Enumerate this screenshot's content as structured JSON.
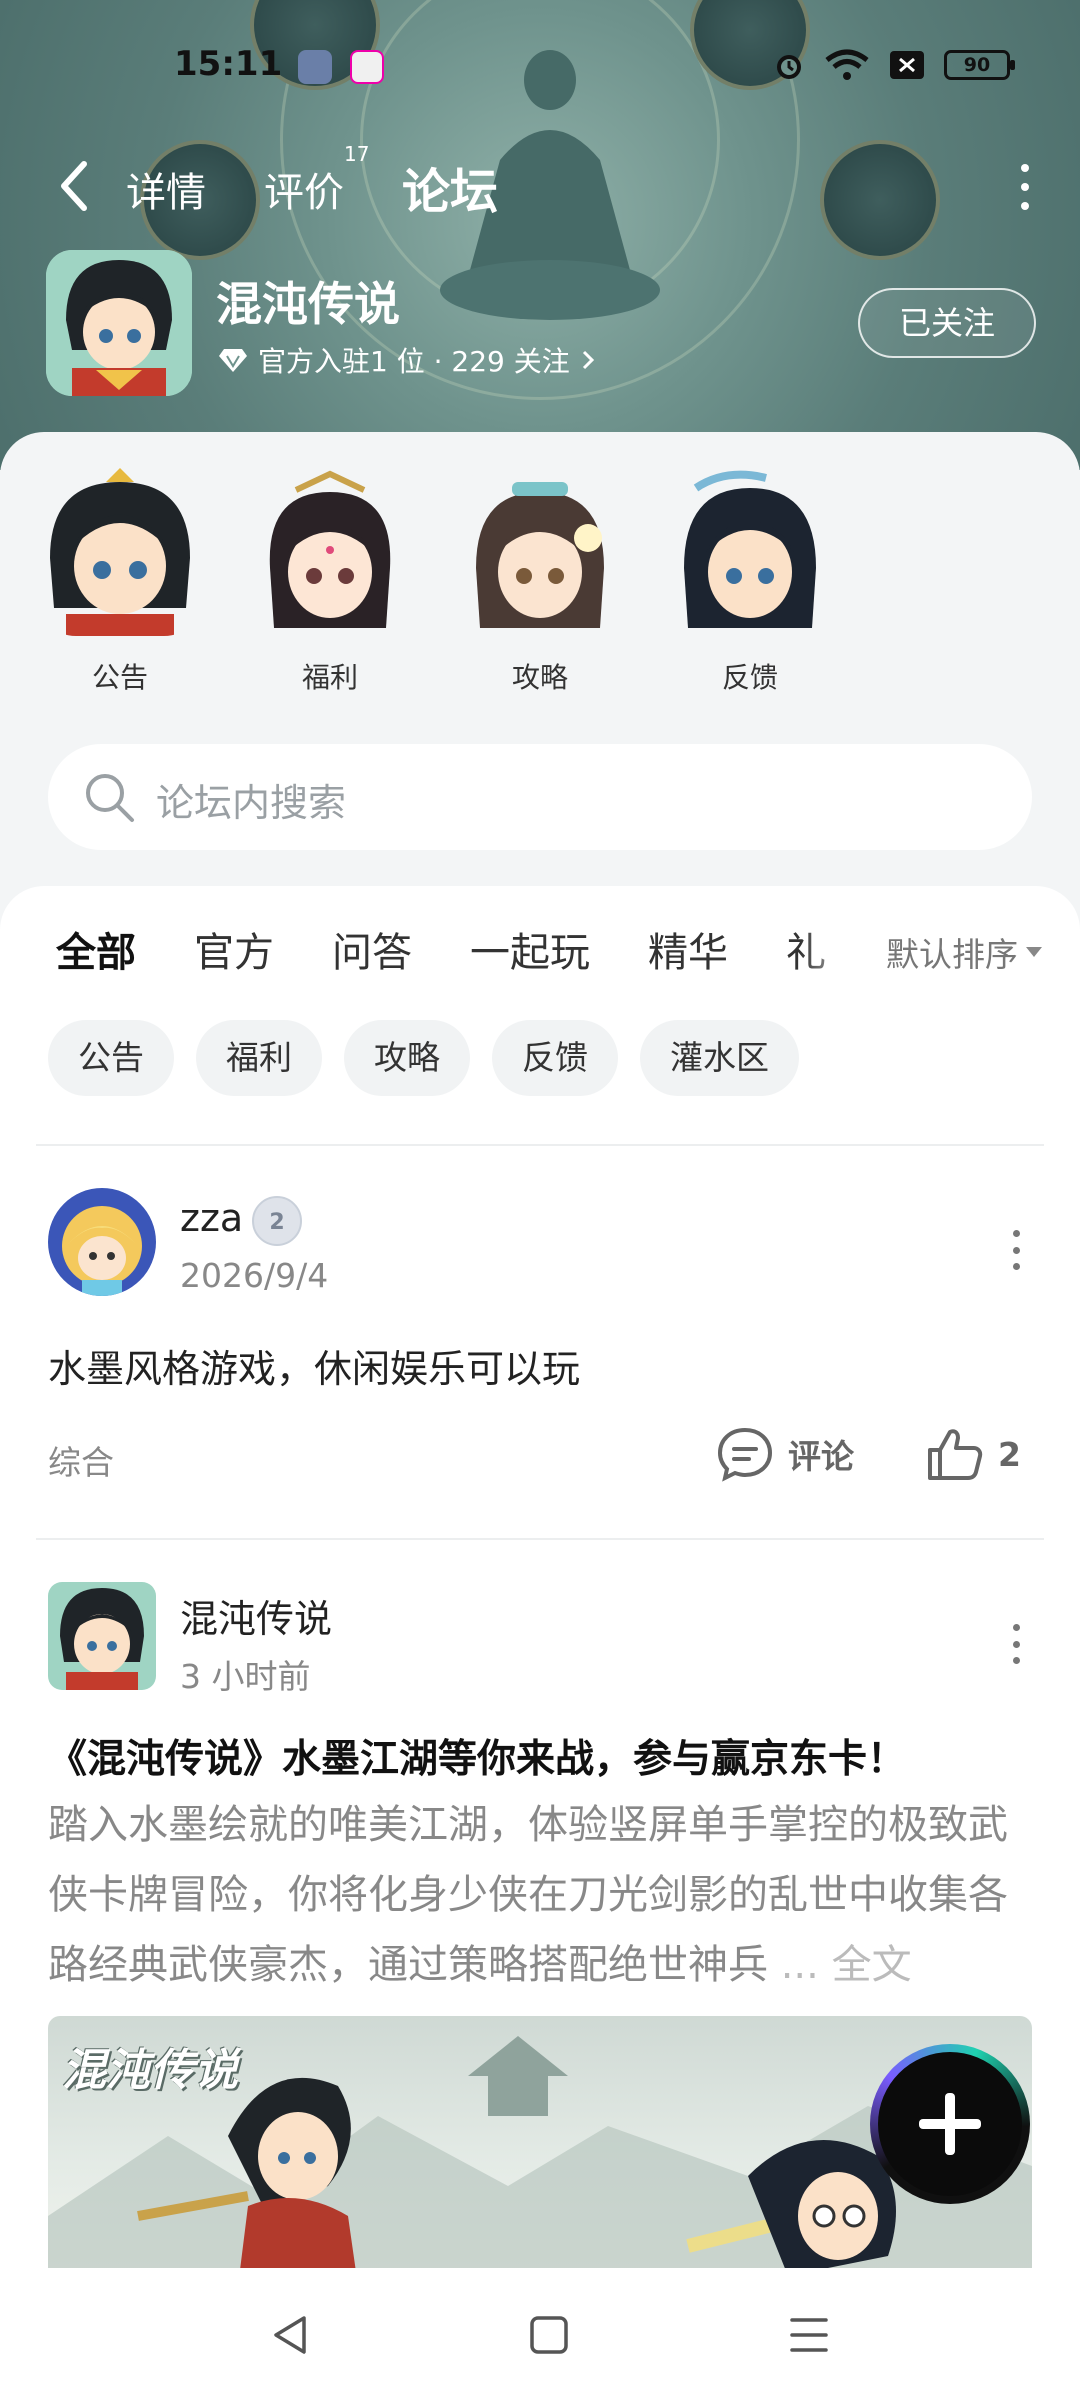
{
  "status_bar": {
    "time": "15:11",
    "battery": "90"
  },
  "nav": {
    "tabs": [
      {
        "label": "详情"
      },
      {
        "label": "评价",
        "count": "17"
      },
      {
        "label": "论坛"
      }
    ]
  },
  "game": {
    "name": "混沌传说",
    "meta": "官方入驻1 位 · 229 关注",
    "follow_label": "已关注"
  },
  "quick_links": [
    {
      "label": "公告"
    },
    {
      "label": "福利"
    },
    {
      "label": "攻略"
    },
    {
      "label": "反馈"
    }
  ],
  "search": {
    "placeholder": "论坛内搜索"
  },
  "filter_tabs": [
    "全部",
    "官方",
    "问答",
    "一起玩",
    "精华",
    "礼"
  ],
  "sort_label": "默认排序",
  "chips": [
    "公告",
    "福利",
    "攻略",
    "反馈",
    "灌水区"
  ],
  "posts": [
    {
      "author": "zza",
      "level": "2",
      "date": "2026/9/4",
      "text": "水墨风格游戏，休闲娱乐可以玩",
      "tag": "综合",
      "comment_label": "评论",
      "likes": "2"
    },
    {
      "author": "混沌传说",
      "date": "3 小时前",
      "title": "《混沌传说》水墨江湖等你来战，参与赢京东卡！",
      "body": "踏入水墨绘就的唯美江湖，体验竖屏单手掌控的极致武侠卡牌冒险，你将化身少侠在刀光剑影的乱世中收集各路经典武侠豪杰，通过策略搭配绝世神兵",
      "more": "... 全文",
      "banner_title": "混沌传说"
    }
  ],
  "colors": {
    "accent": "#19d6a7",
    "header_bg": "#5a7d79"
  }
}
